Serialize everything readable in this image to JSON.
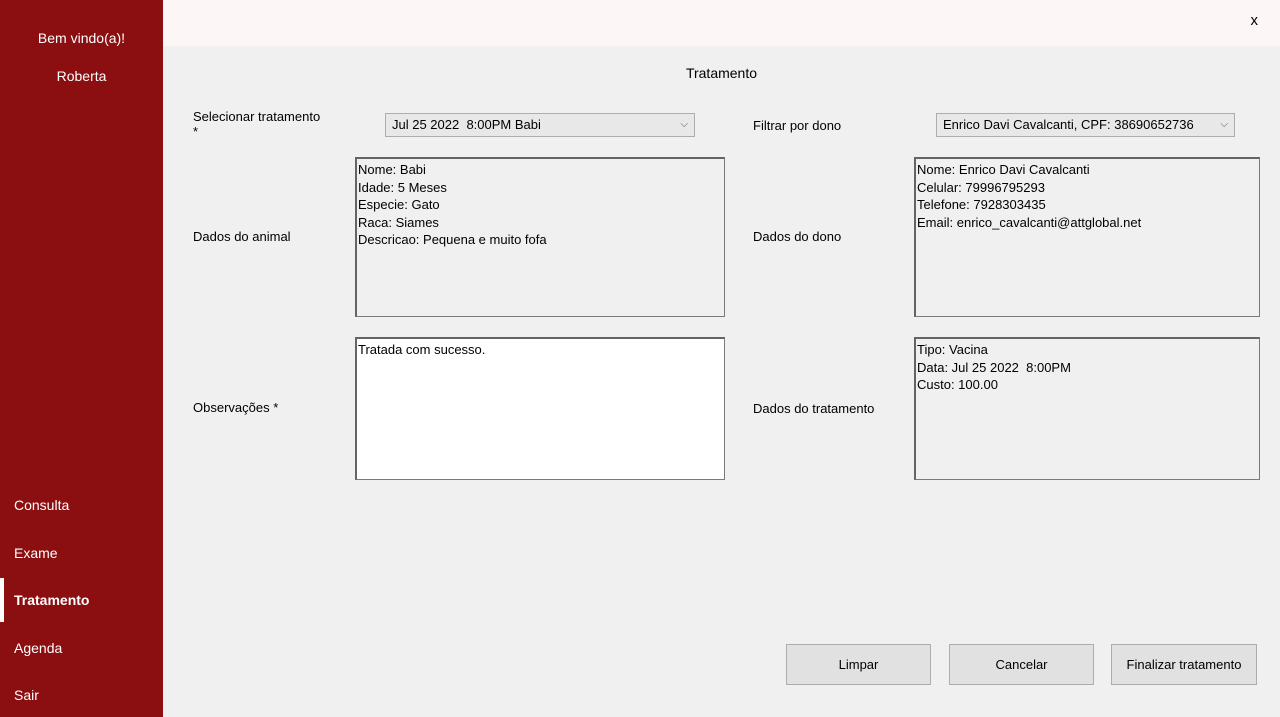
{
  "sidebar": {
    "welcome": "Bem vindo(a)!",
    "user": "Roberta",
    "items": [
      {
        "label": "Consulta"
      },
      {
        "label": "Exame"
      },
      {
        "label": "Tratamento"
      },
      {
        "label": "Agenda"
      },
      {
        "label": "Sair"
      }
    ]
  },
  "topbar": {
    "close_label": "x"
  },
  "page": {
    "title": "Tratamento"
  },
  "form": {
    "select_treatment_label": "Selecionar tratamento",
    "required_mark": "*",
    "treatment_selected": "Jul 25 2022  8:00PM Babi",
    "filter_owner_label": "Filtrar por dono",
    "owner_selected": "Enrico Davi Cavalcanti, CPF: 38690652736",
    "animal_label": "Dados do animal",
    "animal_lines": [
      "Nome: Babi",
      "Idade: 5 Meses",
      "Especie: Gato",
      "Raca: Siames",
      "Descricao: Pequena e muito fofa"
    ],
    "owner_label": "Dados do dono",
    "owner_lines": [
      "Nome: Enrico Davi Cavalcanti",
      "Celular: 79996795293",
      "Telefone: 7928303435",
      "Email: enrico_cavalcanti@attglobal.net"
    ],
    "observations_label": "Observações *",
    "observations_value": "Tratada com sucesso.",
    "treatment_data_label": "Dados do tratamento",
    "treatment_lines": [
      "Tipo: Vacina",
      "Data: Jul 25 2022  8:00PM",
      "Custo: 100.00"
    ]
  },
  "buttons": {
    "clear": "Limpar",
    "cancel": "Cancelar",
    "finish": "Finalizar tratamento"
  },
  "colors": {
    "sidebar_bg": "#8b0e10",
    "page_bg": "#f0f0f0"
  }
}
